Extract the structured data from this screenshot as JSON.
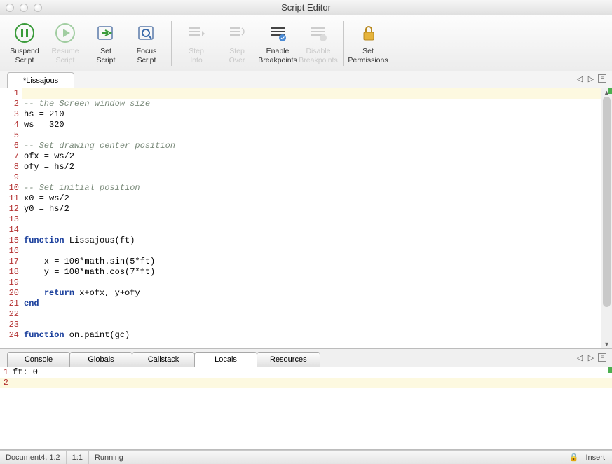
{
  "title": "Script Editor",
  "toolbar": {
    "suspend": "Suspend\nScript",
    "resume": "Resume\nScript",
    "set": "Set\nScript",
    "focus": "Focus\nScript",
    "stepinto": "Step\nInto",
    "stepover": "Step\nOver",
    "enablebp": "Enable\nBreakpoints",
    "disablebp": "Disable\nBreakpoints",
    "setperm": "Set\nPermissions"
  },
  "tab": {
    "name": "*Lissajous"
  },
  "code": {
    "lines": [
      {
        "n": 1,
        "t": "",
        "current": true,
        "cls": ""
      },
      {
        "n": 2,
        "t": "-- the Screen window size",
        "cls": "cm"
      },
      {
        "n": 3,
        "t": "hs = 210",
        "cls": ""
      },
      {
        "n": 4,
        "t": "ws = 320",
        "cls": ""
      },
      {
        "n": 5,
        "t": "",
        "cls": ""
      },
      {
        "n": 6,
        "t": "-- Set drawing center position",
        "cls": "cm"
      },
      {
        "n": 7,
        "t": "ofx = ws/2",
        "cls": ""
      },
      {
        "n": 8,
        "t": "ofy = hs/2",
        "cls": ""
      },
      {
        "n": 9,
        "t": "",
        "cls": ""
      },
      {
        "n": 10,
        "t": "-- Set initial position",
        "cls": "cm"
      },
      {
        "n": 11,
        "t": "x0 = ws/2",
        "cls": ""
      },
      {
        "n": 12,
        "t": "y0 = hs/2",
        "cls": ""
      },
      {
        "n": 13,
        "t": "",
        "cls": ""
      },
      {
        "n": 14,
        "t": "",
        "cls": ""
      },
      {
        "n": 15,
        "html": "<span class='kw'>function</span> Lissajous(ft)"
      },
      {
        "n": 16,
        "t": "",
        "cls": ""
      },
      {
        "n": 17,
        "t": "    x = 100*math.sin(5*ft)",
        "cls": ""
      },
      {
        "n": 18,
        "t": "    y = 100*math.cos(7*ft)",
        "cls": ""
      },
      {
        "n": 19,
        "t": "",
        "cls": ""
      },
      {
        "n": 20,
        "html": "    <span class='kw'>return</span> x+ofx, y+ofy"
      },
      {
        "n": 21,
        "html": "<span class='kw'>end</span>"
      },
      {
        "n": 22,
        "t": "",
        "cls": ""
      },
      {
        "n": 23,
        "t": "",
        "cls": ""
      },
      {
        "n": 24,
        "html": "<span class='kw'>function</span> on.paint(gc)"
      }
    ]
  },
  "panels": {
    "tabs": [
      "Console",
      "Globals",
      "Callstack",
      "Locals",
      "Resources"
    ],
    "active": 3
  },
  "locals": {
    "rows": [
      {
        "n": 1,
        "t": "ft: 0"
      },
      {
        "n": 2,
        "t": "",
        "current": true
      }
    ]
  },
  "status": {
    "doc": "Document4, 1.2",
    "pos": "1:1",
    "run": "Running",
    "mode": "Insert"
  }
}
